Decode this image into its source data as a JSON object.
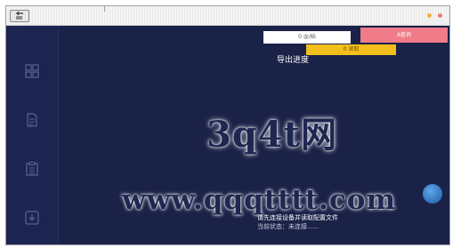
{
  "window": {
    "title": "",
    "controls": [
      "minimize",
      "close"
    ]
  },
  "icons": {
    "app": "back-arrow-icon",
    "nav": [
      "grid-icon",
      "document-icon",
      "clipboard-list-icon",
      "download-box-icon"
    ]
  },
  "toolbar": {
    "white_button_label": "0 @/始",
    "pink_button_label": "A查询",
    "yellow_button_label": "0 读取"
  },
  "status": {
    "text": "导出进度"
  },
  "watermark": {
    "brand": "3q4t网",
    "url": "www.qqqtttt.com"
  },
  "info": {
    "line1": "请先连接设备并读取配置文件",
    "line2": "当前状态：未连接......"
  },
  "colors": {
    "background": "#1a2248",
    "sidebar": "#1c2450",
    "pink": "#ef7c88",
    "yellow": "#f4bf1c",
    "white": "#ffffff"
  }
}
